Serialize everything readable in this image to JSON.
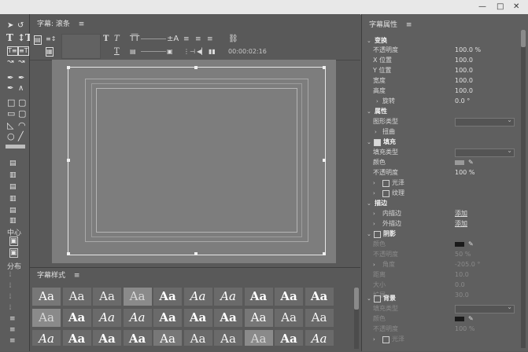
{
  "title_panel": {
    "title": "字幕: 滚条",
    "menu": "≡"
  },
  "toolbar": {
    "timecode": "00:00:02:16",
    "font_placeholder": "T",
    "italic_placeholder": "T"
  },
  "tools": {
    "center_label": "中心",
    "distribute_label": "分布"
  },
  "styles_panel": {
    "title": "字幕样式",
    "menu": "≡",
    "sample": "Aa"
  },
  "props_panel": {
    "title": "字幕属性",
    "menu": "≡",
    "transform": {
      "header": "变换",
      "opacity_label": "不透明度",
      "opacity": "100.0 %",
      "x_label": "X 位置",
      "x": "100.0",
      "y_label": "Y 位置",
      "y": "100.0",
      "width_label": "宽度",
      "width": "100.0",
      "height_label": "高度",
      "height": "100.0",
      "rotation_label": "旋转",
      "rotation": "0.0 °"
    },
    "attributes": {
      "header": "属性",
      "shape_type_label": "图形类型",
      "distort_label": "扭曲"
    },
    "fill": {
      "header": "填充",
      "fill_type_label": "填充类型",
      "color_label": "颜色",
      "opacity_label": "不透明度",
      "opacity": "100 %",
      "sheen_label": "光泽",
      "texture_label": "纹理"
    },
    "stroke": {
      "header": "描边",
      "inner_label": "内描边",
      "inner_action": "添加",
      "outer_label": "外描边",
      "outer_action": "添加"
    },
    "shadow": {
      "header": "阴影",
      "color_label": "颜色",
      "opacity_label": "不透明度",
      "opacity": "50 %",
      "angle_label": "角度",
      "angle": "-205.0 °",
      "distance_label": "距离",
      "distance": "10.0",
      "size_label": "大小",
      "size": "0.0",
      "spread_label": "扩展",
      "spread": "30.0"
    },
    "background": {
      "header": "背景",
      "fill_type_label": "填充类型",
      "color_label": "颜色",
      "opacity_label": "不透明度",
      "opacity": "100 %",
      "sheen_label": "光泽"
    }
  },
  "colors": {
    "fill_swatch": "#9a9a9a",
    "shadow_swatch": "#1a1a1a",
    "bg_swatch": "#1a1a1a"
  }
}
